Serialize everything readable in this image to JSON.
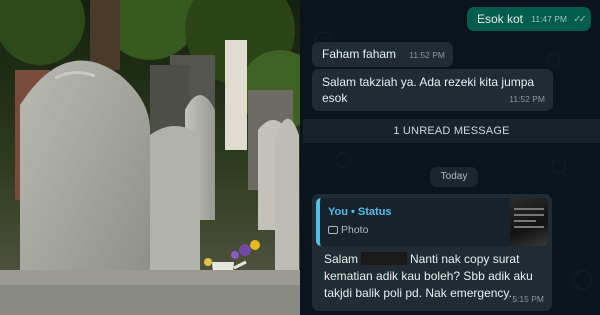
{
  "chat": {
    "messages": [
      {
        "id": "m1",
        "direction": "outgoing",
        "text": "Esok kot",
        "time": "11:47 PM",
        "status": "read"
      },
      {
        "id": "m2",
        "direction": "incoming",
        "text": "Faham faham",
        "time": "11:52 PM"
      },
      {
        "id": "m3",
        "direction": "incoming",
        "lines": [
          "Salam takziah ya. Ada rezeki kita jumpa",
          "esok"
        ],
        "time": "11:52 PM"
      }
    ],
    "unread_banner": "1 UNREAD MESSAGE",
    "day_separator": "Today",
    "reply_message": {
      "quote": {
        "sender": "You • Status",
        "type_label": "Photo",
        "icon": "camera-icon"
      },
      "lines": [
        "Salam",
        "Nanti nak copy surat",
        "kematian adik kau boleh? Sbb adik aku",
        "takjdi balik poli pd. Nak emergency."
      ],
      "time": "5:15 PM"
    }
  },
  "colors": {
    "chat_bg": "#0b141a",
    "incoming_bubble": "#202c33",
    "outgoing_bubble": "#005c4b",
    "status_accent": "#53bdeb"
  }
}
